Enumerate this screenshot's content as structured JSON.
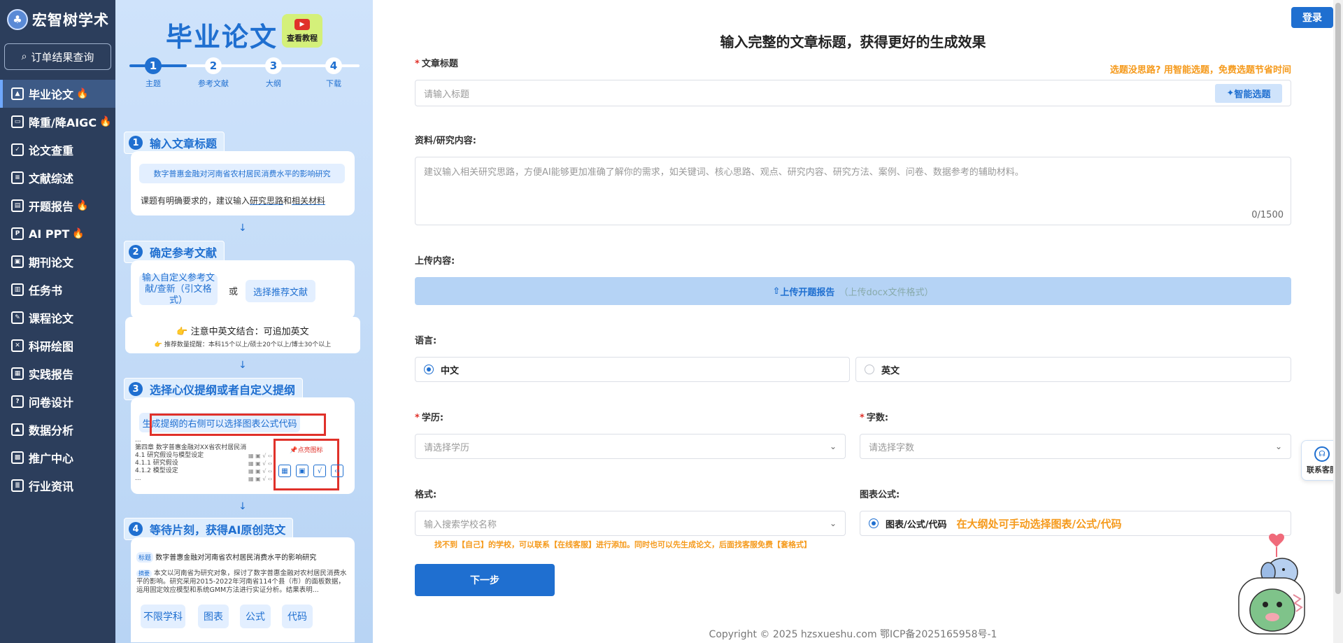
{
  "sidebar": {
    "logo": "宏智树学术",
    "order_btn": "订单结果查询",
    "items": [
      {
        "label": "毕业论文",
        "hot": true
      },
      {
        "label": "降重/降AIGC",
        "hot": true
      },
      {
        "label": "论文查重",
        "hot": false
      },
      {
        "label": "文献综述",
        "hot": false
      },
      {
        "label": "开题报告",
        "hot": true
      },
      {
        "label": "AI PPT",
        "hot": true
      },
      {
        "label": "期刊论文",
        "hot": false
      },
      {
        "label": "任务书",
        "hot": false
      },
      {
        "label": "课程论文",
        "hot": false
      },
      {
        "label": "科研绘图",
        "hot": false
      },
      {
        "label": "实践报告",
        "hot": false
      },
      {
        "label": "问卷设计",
        "hot": false
      },
      {
        "label": "数据分析",
        "hot": false
      },
      {
        "label": "推广中心",
        "hot": false
      },
      {
        "label": "行业资讯",
        "hot": false
      }
    ]
  },
  "guide": {
    "title": "毕业论文",
    "tutorial": "查看教程",
    "steps": [
      {
        "num": "1",
        "label": "主题"
      },
      {
        "num": "2",
        "label": "参考文献"
      },
      {
        "num": "3",
        "label": "大纲"
      },
      {
        "num": "4",
        "label": "下载"
      }
    ],
    "s1": {
      "num": "1",
      "title": "输入文章标题",
      "example": "数字普惠金融对河南省农村居民消费水平的影响研究",
      "tip_a": "课题有明确要求的，建议输入",
      "tip_b": "研究思路",
      "tip_c": "和",
      "tip_d": "相关材料"
    },
    "s2": {
      "num": "2",
      "title": "确定参考文献",
      "custom": "输入自定义参考文献/查新（引文格式）",
      "or": "或",
      "recommend": "选择推荐文献",
      "note": "注意中英文结合：可追加英文",
      "count": "推荐数量提醒：本科15个以上/硕士20个以上/博士30个以上"
    },
    "s3": {
      "num": "3",
      "title": "选择心仪提纲或者自定义提纲",
      "hint": "生成提纲的右侧可以选择图表公式代码",
      "outline": [
        "...",
        "第四章 数字普惠金融对XX省农村居民消",
        "4.1 研究假设与模型设定",
        "4.1.1 研究假设",
        "4.1.2 模型设定",
        "..."
      ],
      "click_icon": "点亮图标"
    },
    "s4": {
      "num": "4",
      "title": "等待片刻，获得AI原创范文",
      "tag_title": "标题",
      "paper_title": "数字普惠金融对河南省农村居民消费水平的影响研究",
      "tag_abstract": "摘要",
      "abstract": "本文以河南省为研究对象，探讨了数字普惠金融对农村居民消费水平的影响。研究采用2015-2022年河南省114个县（市）的面板数据，运用固定效应模型和系统GMM方法进行实证分析。结果表明...",
      "chips": [
        "不限学科",
        "图表",
        "公式",
        "代码"
      ]
    }
  },
  "main": {
    "login": "登录",
    "headline": "输入完整的文章标题，获得更好的生成效果",
    "title_label": "文章标题",
    "title_tip": "选题没思路? 用智能选题，免费选题节省时间",
    "title_placeholder": "请输入标题",
    "smart_btn": "智能选题",
    "material_label": "资料/研究内容:",
    "material_placeholder": "建议输入相关研究思路，方便AI能够更加准确了解你的需求，如关键词、核心思路、观点、研究内容、研究方法、案例、问卷、数据参考的辅助材料。",
    "material_count": "0/1500",
    "upload_label": "上传内容:",
    "upload_btn": "上传开题报告",
    "upload_hint": "（上传docx文件格式）",
    "lang_label": "语言:",
    "lang_zh": "中文",
    "lang_en": "英文",
    "edu_label": "学历:",
    "edu_placeholder": "请选择学历",
    "words_label": "字数:",
    "words_placeholder": "请选择字数",
    "format_label": "格式:",
    "format_placeholder": "输入搜索学校名称",
    "format_tip": "找不到【自己】的学校，可以联系【在线客服】进行添加。同时也可以先生成论文，后面找客服免费【套格式】",
    "chart_label": "图表公式:",
    "chart_option": "图表/公式/代码",
    "chart_tip": "在大纲处可手动选择图表/公式/代码",
    "next_btn": "下一步",
    "copyright": "Copyright © 2025 hzsxueshu.com 鄂ICP备2025165958号-1"
  },
  "float": {
    "kefu": "联系客服"
  },
  "colors": {
    "sidebar": "#2c3e5c",
    "accent": "#1f6fd0",
    "orange": "#f59a1c",
    "red": "#e0312a"
  }
}
